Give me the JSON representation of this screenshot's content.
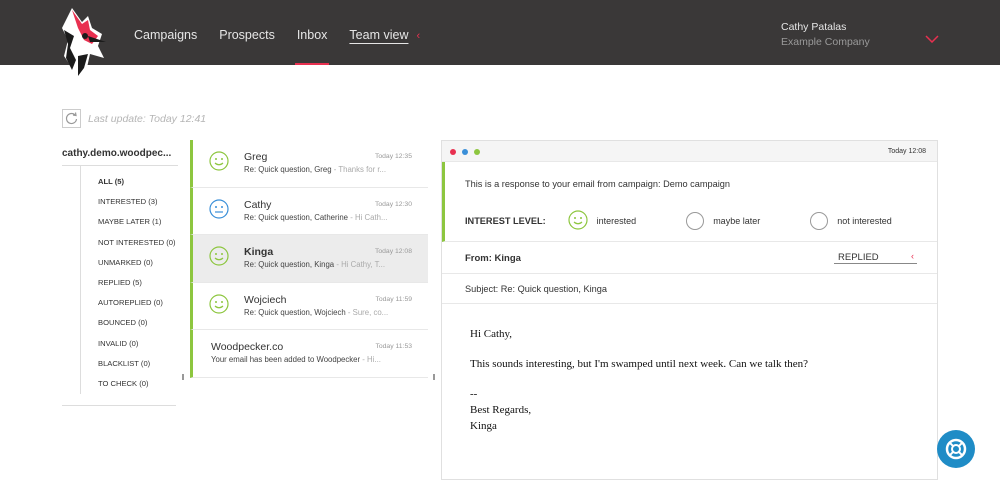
{
  "nav": {
    "items": [
      "Campaigns",
      "Prospects",
      "Inbox",
      "Team view"
    ],
    "active": "Inbox"
  },
  "user": {
    "name": "Cathy Patalas",
    "company": "Example Company"
  },
  "last_update": "Last update: Today 12:41",
  "sidebar": {
    "account": "cathy.demo.woodpec...",
    "folders": [
      "ALL (5)",
      "INTERESTED (3)",
      "MAYBE LATER (1)",
      "NOT INTERESTED (0)",
      "UNMARKED (0)",
      "REPLIED (5)",
      "AUTOREPLIED (0)",
      "BOUNCED (0)",
      "INVALID (0)",
      "BLACKLIST (0)",
      "TO CHECK (0)"
    ]
  },
  "messages": [
    {
      "name": "Greg",
      "time": "Today 12:35",
      "subject": "Re: Quick question, Greg",
      "preview": "- Thanks for r...",
      "mood": "interested"
    },
    {
      "name": "Cathy",
      "time": "Today 12:30",
      "subject": "Re: Quick question, Catherine",
      "preview": "- Hi Cath...",
      "mood": "maybe"
    },
    {
      "name": "Kinga",
      "time": "Today 12:08",
      "subject": "Re: Quick question, Kinga",
      "preview": "- Hi Cathy, T...",
      "mood": "interested"
    },
    {
      "name": "Wojciech",
      "time": "Today 11:59",
      "subject": "Re: Quick question, Wojciech",
      "preview": "- Sure, co...",
      "mood": "interested"
    },
    {
      "name": "Woodpecker.co",
      "time": "Today 11:53",
      "subject": "Your email has been added to Woodpecker",
      "preview": "- Hi...",
      "mood": "none"
    }
  ],
  "detail": {
    "timestamp": "Today 12:08",
    "response_line": "This is a response to your email from campaign: Demo campaign",
    "interest_label": "INTEREST LEVEL:",
    "options": [
      "interested",
      "maybe later",
      "not interested"
    ],
    "from": "From: Kinga",
    "status": "REPLIED",
    "subject": "Subject: Re: Quick question, Kinga",
    "body": {
      "greeting": "Hi Cathy,",
      "text": "This sounds interesting, but I'm swamped until next week. Can we talk then?",
      "sep": "--",
      "sign1": "Best Regards,",
      "sign2": "Kinga"
    }
  },
  "colors": {
    "topbar": "#3a3838",
    "accent": "#e83050",
    "green": "#8dc63f",
    "help": "#1f8cc6",
    "face_green": "#8dc63f",
    "face_blue": "#3a8fd8"
  }
}
